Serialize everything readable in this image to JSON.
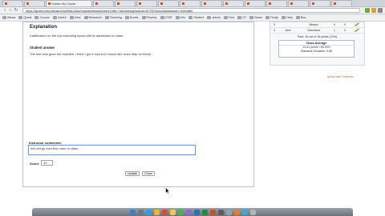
{
  "browser": {
    "tabs": [
      {
        "label": "",
        "active": false
      },
      {
        "label": "",
        "active": false
      },
      {
        "label": "Grades: My Course",
        "active": true
      },
      {
        "label": "",
        "active": false
      },
      {
        "label": "",
        "active": false
      },
      {
        "label": "",
        "active": false
      },
      {
        "label": "",
        "active": false
      },
      {
        "label": "",
        "active": false
      },
      {
        "label": "",
        "active": false
      },
      {
        "label": "",
        "active": false
      },
      {
        "label": "",
        "active": false
      },
      {
        "label": "",
        "active": false
      },
      {
        "label": "",
        "active": false
      },
      {
        "label": "",
        "active": false
      },
      {
        "label": "",
        "active": false
      },
      {
        "label": "",
        "active": false
      }
    ],
    "url": "https://quest.cns.utexas.edu/instructor/modulesession/view?offe=7&learningmodule=87297&modulesession=4164860",
    "bookmarks": [
      "iNews",
      "Quest",
      "Course",
      "Useful",
      "Jobs",
      "Research",
      "Teaching",
      "Books",
      "Physics",
      "UTAT",
      "Info",
      "Student",
      "admin",
      "Find",
      "UT",
      "News",
      "Trinity",
      "Help",
      "Bus"
    ]
  },
  "card": {
    "title": "Explanation",
    "clarification": "Clarification on the top confusing topics will be addressed in class.",
    "student_answer_label": "Student answer",
    "student_answer": "The test solo gave the troubles. I think I got it now but I would like more help on these.",
    "comments_label": "Instructor comments:",
    "comments_value": "We will go over this more in class",
    "score_label": "Score:",
    "score_value": "10",
    "update_button": "Update",
    "close_button": "Close"
  },
  "summary": {
    "header_row": {
      "c1": "3",
      "c2": "",
      "c3": "Missed",
      "c4": "0",
      "c5": "0",
      "c6": ""
    },
    "row": {
      "c1": "3",
      "c2": "view",
      "c3": "Submitted",
      "c4": "1",
      "c5": "0",
      "c6": ""
    },
    "total": "Total: 16 out of 16 points (13%)",
    "average_title": "Class Average",
    "average_points": "14.61 points / 85.00%",
    "std_dev": "Standard Deviation: 4.86",
    "show_late": "show late Submits"
  },
  "colors": {
    "accent_link": "#b3653a",
    "focus_border": "#6f9bd0",
    "pencil": "#7a9a2e"
  }
}
